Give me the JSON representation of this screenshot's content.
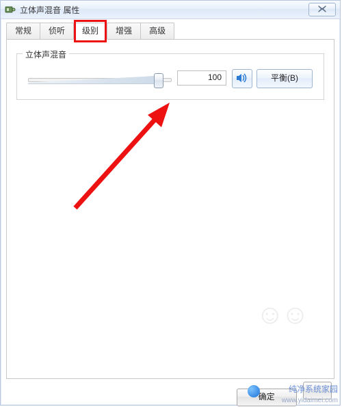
{
  "window": {
    "title": "立体声混音 属性"
  },
  "tabs": [
    {
      "id": "general",
      "label": "常规"
    },
    {
      "id": "listen",
      "label": "侦听"
    },
    {
      "id": "levels",
      "label": "级别"
    },
    {
      "id": "enhance",
      "label": "增强"
    },
    {
      "id": "advanced",
      "label": "高级"
    }
  ],
  "active_tab": "levels",
  "group": {
    "title": "立体声混音",
    "value": "100",
    "balance_label": "平衡(B)"
  },
  "buttons": {
    "ok": "确定"
  },
  "watermark": {
    "line1": "纯净系统家园",
    "line2": "www.yidaimei.com"
  },
  "icons": {
    "app": "sound-device-icon",
    "close": "close-icon",
    "speaker": "speaker-icon"
  }
}
